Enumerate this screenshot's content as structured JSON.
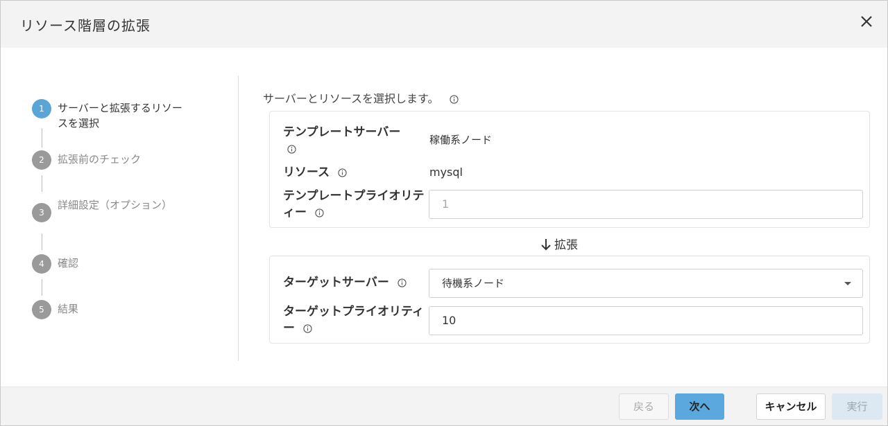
{
  "dialog": {
    "title": "リソース階層の拡張"
  },
  "stepper": {
    "steps": [
      {
        "number": "1",
        "label": "サーバーと拡張するリソースを選択",
        "active": true
      },
      {
        "number": "2",
        "label": "拡張前のチェック",
        "active": false
      },
      {
        "number": "3",
        "label": "詳細設定（オプション）",
        "active": false
      },
      {
        "number": "4",
        "label": "確認",
        "active": false
      },
      {
        "number": "5",
        "label": "結果",
        "active": false
      }
    ]
  },
  "main": {
    "intro": "サーバーとリソースを選択します。",
    "source": {
      "template_server_label": "テンプレートサーバー",
      "template_server_value": "稼働系ノード",
      "resource_label": "リソース",
      "resource_value": "mysql",
      "template_priority_label": "テンプレートプライオリティー",
      "template_priority_value": "1"
    },
    "expand_label": "拡張",
    "target": {
      "target_server_label": "ターゲットサーバー",
      "target_server_value": "待機系ノード",
      "target_priority_label": "ターゲットプライオリティー",
      "target_priority_value": "10"
    }
  },
  "footer": {
    "back_label": "戻る",
    "next_label": "次へ",
    "cancel_label": "キャンセル",
    "run_label": "実行"
  },
  "colors": {
    "accent": "#5aa8dd",
    "active_step": "#5aa5d8",
    "inactive_step": "#9a9a9a"
  }
}
